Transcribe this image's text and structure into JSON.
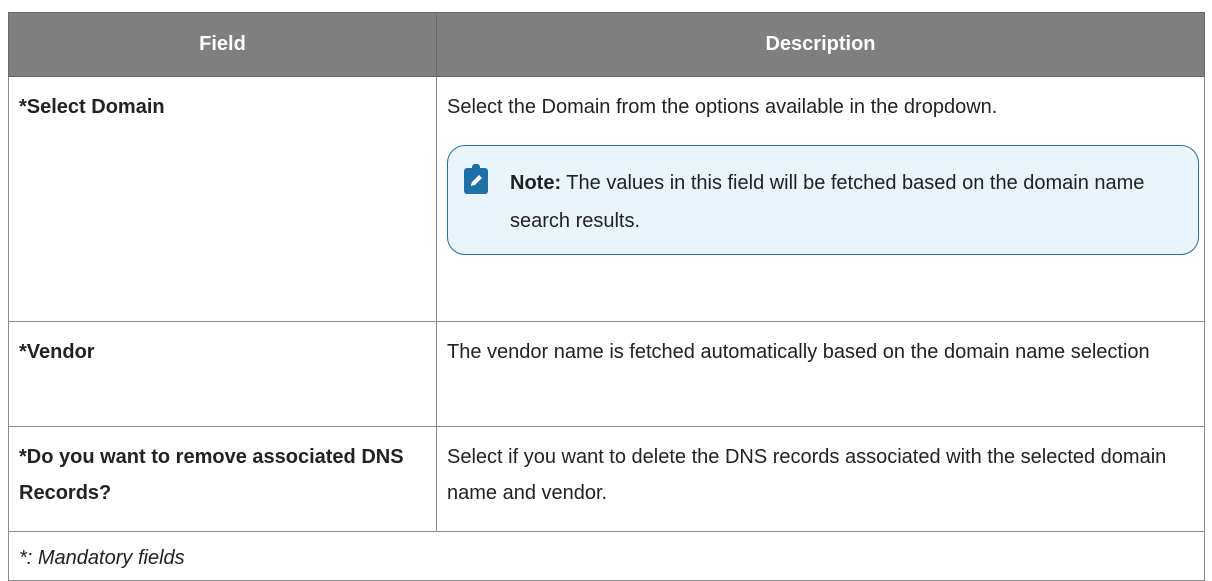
{
  "table": {
    "headers": {
      "field": "Field",
      "description": "Description"
    },
    "rows": [
      {
        "field": "*Select Domain",
        "description": "Select the Domain from the options available in the dropdown.",
        "note": {
          "label": "Note:",
          "text": " The values in this field will be fetched based on the domain name search results."
        }
      },
      {
        "field": "*Vendor",
        "description": "The vendor name is fetched automatically based on the domain name selection"
      },
      {
        "field": "*Do you want to remove associated DNS Records?",
        "description": "Select if you want to delete the DNS records associated with the selected domain name and vendor."
      }
    ],
    "footer": "*: Mandatory fields"
  },
  "icons": {
    "note_icon": "pencil-on-clipboard-icon"
  },
  "colors": {
    "header_bg": "#7f7f7f",
    "note_border": "#1f6fa8",
    "note_bg": "#eaf4fb"
  }
}
